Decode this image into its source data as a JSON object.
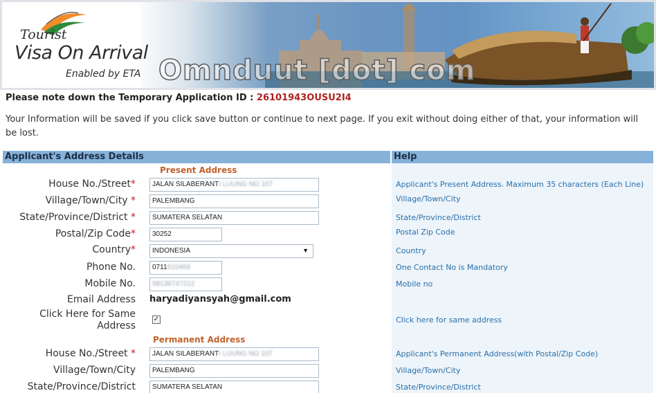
{
  "banner": {
    "logo_tourist": "Tourist",
    "logo_main": "Visa On Arrival",
    "logo_sub": "Enabled by ETA",
    "watermark": "Omnduut [dot] com",
    "colors": {
      "saffron": "#f28c28",
      "green": "#2e8b3c"
    }
  },
  "notice": {
    "app_id_label": "Please note down the Temporary Application ID :",
    "app_id_value": "26101943OUSU2I4",
    "info": "Your Information will be saved if you click save button or continue to next page. If you exit without doing either of that, your information will be lost."
  },
  "headers": {
    "left": "Applicant's Address Details",
    "right": "Help"
  },
  "present": {
    "title": "Present Address",
    "house_label": "House No./Street",
    "house_value_visible": "JALAN SILABERANT",
    "house_value_blurred": "I LUUNG NO 107",
    "village_label": "Village/Town/City",
    "village_value": "PALEMBANG",
    "state_label": "State/Province/District",
    "state_value": "SUMATERA SELATAN",
    "postal_label": "Postal/Zip Code",
    "postal_value": "30252",
    "country_label": "Country",
    "country_value": "INDONESIA",
    "phone_label": "Phone No.",
    "phone_value_visible": "0711",
    "phone_value_blurred": "510469",
    "mobile_label": "Mobile No.",
    "mobile_value_blurred": "08136747212",
    "email_label": "Email Address",
    "email_value": "haryadiyansyah@gmail.com",
    "same_label_1": "Click Here for Same",
    "same_label_2": "Address",
    "same_checked": "✓"
  },
  "permanent": {
    "title": "Permanent Address",
    "house_label": "House No./Street",
    "house_value_visible": "JALAN SILABERANT",
    "house_value_blurred": "I LUUNG NO 107",
    "village_label": "Village/Town/City",
    "village_value": "PALEMBANG",
    "state_label": "State/Province/District",
    "state_value": "SUMATERA SELATAN"
  },
  "help": {
    "house": "Applicant's Present Address. Maximum 35 characters (Each Line)",
    "village": "Village/Town/City",
    "state": "State/Province/District",
    "postal": "Postal Zip Code",
    "country": "Country",
    "phone": "One Contact No is Mandatory",
    "mobile": "Mobile no",
    "same": "Click here for same address",
    "perm_house": "Applicant's Permanent Address(with Postal/Zip Code)",
    "perm_village": "Village/Town/City",
    "perm_state": "State/Province/District"
  },
  "required_mark": "*",
  "dropdown_icon": "triangle-down-icon"
}
